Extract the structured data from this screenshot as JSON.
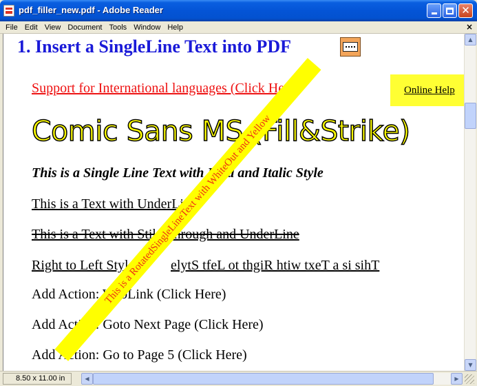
{
  "window": {
    "title": "pdf_filler_new.pdf - Adobe Reader",
    "icon": "adobe-reader-icon"
  },
  "menu": {
    "items": [
      "File",
      "Edit",
      "View",
      "Document",
      "Tools",
      "Window",
      "Help"
    ],
    "close_glyph": "×"
  },
  "document": {
    "heading": "1. Insert a SingleLine Text into PDF",
    "intl_link": "Support for International languages (Click Here)",
    "online_help": "Online Help",
    "comic_text": "Comic Sans MS (Fill&Strike)",
    "bold_italic": "This is a Single Line Text with Bold and Italic Style",
    "underline_text": "This is a Text with UnderLine",
    "strike_text": "This is a Text with StikeThrough and UnderLine",
    "rtl_label": "Right to Left Style:",
    "rtl_value": "elytS tfeL ot thgiR htiw txeT a si sihT",
    "action_weblink": "Add Action: WebLink (Click Here)",
    "action_next": "Add Action: Goto Next Page (Click Here)",
    "action_page5": "Add Action: Go to Page 5 (Click Here)",
    "diagonal_text": "This is a RotatedSingleLineText with WhiteOut and Yellow",
    "colors": {
      "heading": "#1a1ad8",
      "link": "#e11111",
      "highlight": "#ffff00",
      "diagonal_text": "#ee3311"
    }
  },
  "statusbar": {
    "page_size": "8.50 x 11.00 in"
  }
}
